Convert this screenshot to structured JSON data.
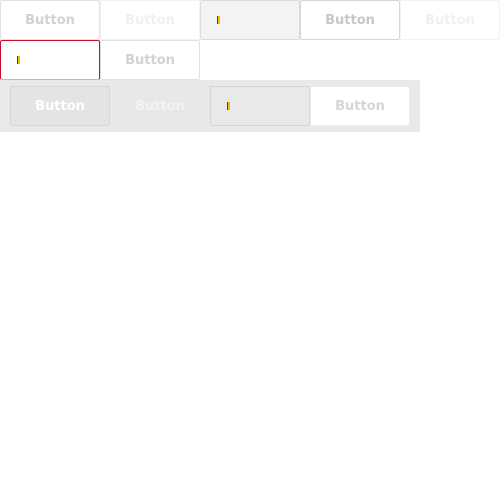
{
  "row1": {
    "b1": "Button",
    "b2": "Button",
    "b4": "Button",
    "b5": "Button"
  },
  "row2": {
    "b2": "Button"
  },
  "panel": {
    "b1": "Button",
    "b2": "Button",
    "b4": "Button"
  }
}
